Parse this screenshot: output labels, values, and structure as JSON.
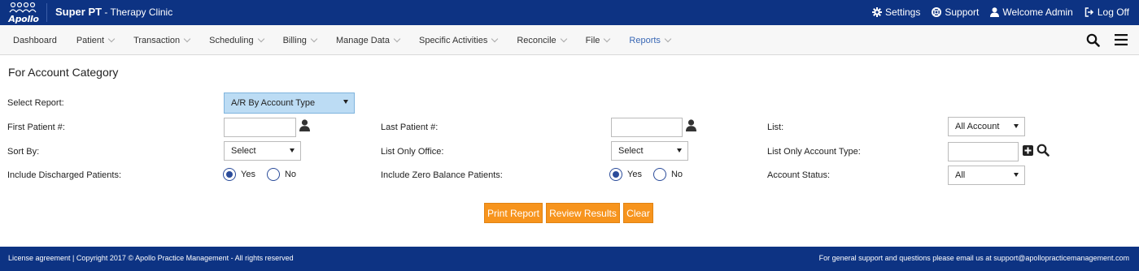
{
  "app": {
    "logo_text": "Apollo",
    "title": "Super PT",
    "subtitle": " - Therapy Clinic"
  },
  "toplinks": {
    "settings": "Settings",
    "support": "Support",
    "welcome": "Welcome Admin",
    "logoff": "Log Off"
  },
  "nav": {
    "items": [
      {
        "label": "Dashboard",
        "has_menu": false
      },
      {
        "label": "Patient",
        "has_menu": true
      },
      {
        "label": "Transaction",
        "has_menu": true
      },
      {
        "label": "Scheduling",
        "has_menu": true
      },
      {
        "label": "Billing",
        "has_menu": true
      },
      {
        "label": "Manage Data",
        "has_menu": true
      },
      {
        "label": "Specific Activities",
        "has_menu": true
      },
      {
        "label": "Reconcile",
        "has_menu": true
      },
      {
        "label": "File",
        "has_menu": true
      },
      {
        "label": "Reports",
        "has_menu": true,
        "active": true
      }
    ]
  },
  "page": {
    "title": "For Account Category"
  },
  "form": {
    "select_report_label": "Select Report:",
    "select_report_value": "A/R By Account Type",
    "first_patient_label": "First Patient #:",
    "first_patient_value": "",
    "last_patient_label": "Last Patient #:",
    "last_patient_value": "",
    "list_label": "List:",
    "list_value": "All Account",
    "sort_by_label": "Sort By:",
    "sort_by_value": "Select",
    "list_only_office_label": "List Only Office:",
    "list_only_office_value": "Select",
    "list_only_account_type_label": "List Only Account Type:",
    "list_only_account_type_value": "",
    "include_discharged_label": "Include Discharged Patients:",
    "include_discharged_yes": "Yes",
    "include_discharged_no": "No",
    "include_discharged_selected": "Yes",
    "include_zero_balance_label": "Include Zero Balance Patients:",
    "include_zero_balance_yes": "Yes",
    "include_zero_balance_no": "No",
    "include_zero_balance_selected": "Yes",
    "account_status_label": "Account Status:",
    "account_status_value": "All"
  },
  "buttons": {
    "print_report": "Print Report",
    "review_results": "Review Results",
    "clear": "Clear"
  },
  "footer": {
    "left": "License agreement | Copyright 2017 © Apollo Practice Management - All rights reserved",
    "right": "For general support and questions please email us at support@apollopracticemanagement.com"
  },
  "colors": {
    "header_bg": "#0d3383",
    "accent_button": "#f7941d",
    "active_nav": "#3a68b5",
    "selected_dropdown": "#bcdcf4"
  }
}
